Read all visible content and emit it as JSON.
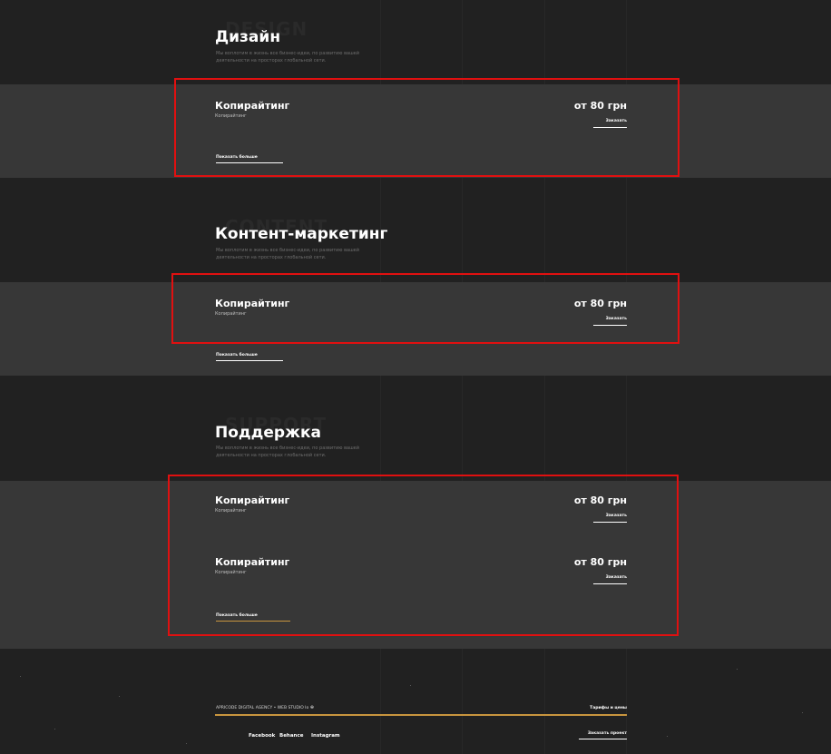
{
  "sections": [
    {
      "ghost": "DESIGN",
      "title": "Дизайн",
      "desc": "Мы воплотим в жизнь все бизнес-идеи, по развитию вашей деятельности на просторах глобальной сети.",
      "services": [
        {
          "name": "Копирайтинг",
          "sub": "Копирайтинг",
          "price": "от 80 грн",
          "link": "Заказать"
        }
      ],
      "show_all": "Показать больше"
    },
    {
      "ghost": "CONTENT",
      "title": "Контент-маркетинг",
      "desc": "Мы воплотим в жизнь все бизнес-идеи, по развитию вашей деятельности на просторах глобальной сети.",
      "services": [
        {
          "name": "Копирайтинг",
          "sub": "Копирайтинг",
          "price": "от 80 грн",
          "link": "Заказать"
        }
      ],
      "show_all": "Показать больше"
    },
    {
      "ghost": "SUPPORT",
      "title": "Поддержка",
      "desc": "Мы воплотим в жизнь все бизнес-идеи, по развитию вашей деятельности на просторах глобальной сети.",
      "services": [
        {
          "name": "Копирайтинг",
          "sub": "Копирайтинг",
          "price": "от 80 грн",
          "link": "Заказать"
        },
        {
          "name": "Копирайтинг",
          "sub": "Копирайтинг",
          "price": "от 80 грн",
          "link": "Заказать"
        }
      ],
      "show_all": "Показать больше"
    }
  ],
  "footer": {
    "copyright": "APRICODE DIGITAL AGENCY • WEB STUDIO Іо",
    "copyright_mark": "®",
    "rates_link": "Тарифы и цены",
    "social": [
      "Facebook",
      "Behance",
      "Instagram"
    ],
    "cta": "Заказать проект"
  },
  "colors": {
    "page_bg": "#212121",
    "band_bg": "#373737",
    "accent_gold": "#c8953e",
    "highlight_red": "#e01010"
  }
}
